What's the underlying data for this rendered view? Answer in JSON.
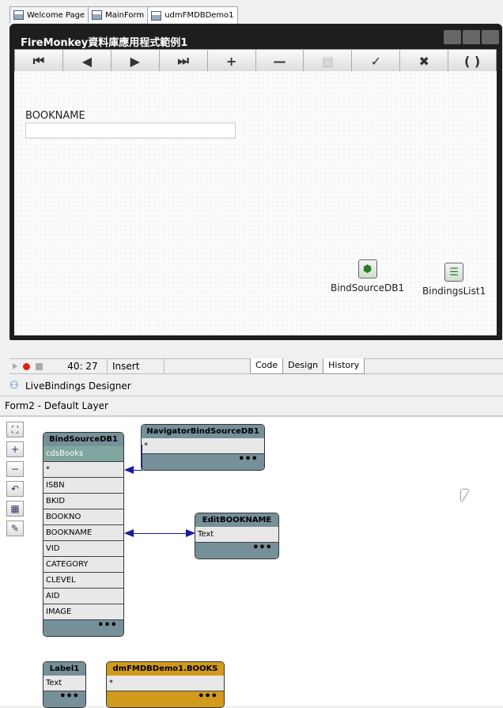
{
  "file_tabs": [
    {
      "label": "Welcome Page"
    },
    {
      "label": "MainForm"
    },
    {
      "label": "udmFMDBDemo1"
    }
  ],
  "form": {
    "title": "FireMonkey資料庫應用程式範例1",
    "navigator_buttons": [
      {
        "icon": "first-record-icon",
        "glyph": "⏮"
      },
      {
        "icon": "prior-record-icon",
        "glyph": "◀"
      },
      {
        "icon": "next-record-icon",
        "glyph": "▶"
      },
      {
        "icon": "last-record-icon",
        "glyph": "⏭"
      },
      {
        "icon": "insert-record-icon",
        "glyph": "+"
      },
      {
        "icon": "delete-record-icon",
        "glyph": "—"
      },
      {
        "icon": "edit-record-icon",
        "glyph": "▤"
      },
      {
        "icon": "post-record-icon",
        "glyph": "✓"
      },
      {
        "icon": "cancel-edit-icon",
        "glyph": "✖"
      },
      {
        "icon": "refresh-icon",
        "glyph": "( )"
      }
    ],
    "book_label": "BOOKNAME",
    "book_edit_value": "",
    "components": [
      {
        "label": "BindSourceDB1"
      },
      {
        "label": "BindingsList1"
      }
    ]
  },
  "status_bar": {
    "position": "40: 27",
    "mode": "Insert",
    "tabs": [
      "Code",
      "Design",
      "History"
    ],
    "active_tab": "Design"
  },
  "livebindings": {
    "title": "LiveBindings Designer",
    "layer": "Form2  - Default Layer"
  },
  "diagram": {
    "bindsource": {
      "title": "BindSourceDB1",
      "rows": [
        "cdsBooks",
        "*",
        "ISBN",
        "BKID",
        "BOOKNO",
        "BOOKNAME",
        "VID",
        "CATEGORY",
        "CLEVEL",
        "AID",
        "IMAGE"
      ]
    },
    "navigator": {
      "title": "NavigatorBindSourceDB1",
      "rows": [
        "*"
      ]
    },
    "edit": {
      "title": "EditBOOKNAME",
      "rows": [
        "Text"
      ]
    },
    "label": {
      "title": "Label1",
      "rows": [
        "Text"
      ]
    },
    "dataset": {
      "title": "dmFMDBDemo1.BOOKS",
      "rows": [
        "*"
      ]
    },
    "footer": "•••"
  },
  "colors": {
    "box_header": "#76909a",
    "dataset_header": "#d19a1c",
    "link": "#1a1aa0"
  }
}
